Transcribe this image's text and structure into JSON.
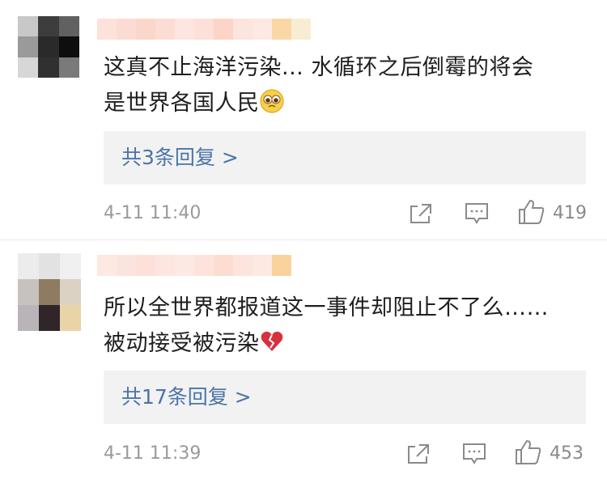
{
  "comments": [
    {
      "text_line1": "这真不止海洋污染... 水循环之后倒霉的将会",
      "text_line2": "是世界各国人民",
      "emoji": "pleading-face-emoji",
      "replies": "共3条回复 >",
      "time": "4-11 11:40",
      "likes": "419"
    },
    {
      "text_line1": "所以全世界都报道这一事件却阻止不了么……",
      "text_line2": "被动接受被污染",
      "emoji": "broken-heart-emoji",
      "replies": "共17条回复 >",
      "time": "4-11 11:39",
      "likes": "453"
    }
  ],
  "icons": {
    "share": "share-icon",
    "comment": "comment-icon",
    "like": "thumbs-up-icon"
  },
  "colors": {
    "reply_link": "#4a74a9",
    "meta_text": "#9a9a9a",
    "reply_bg": "#f2f2f2"
  }
}
